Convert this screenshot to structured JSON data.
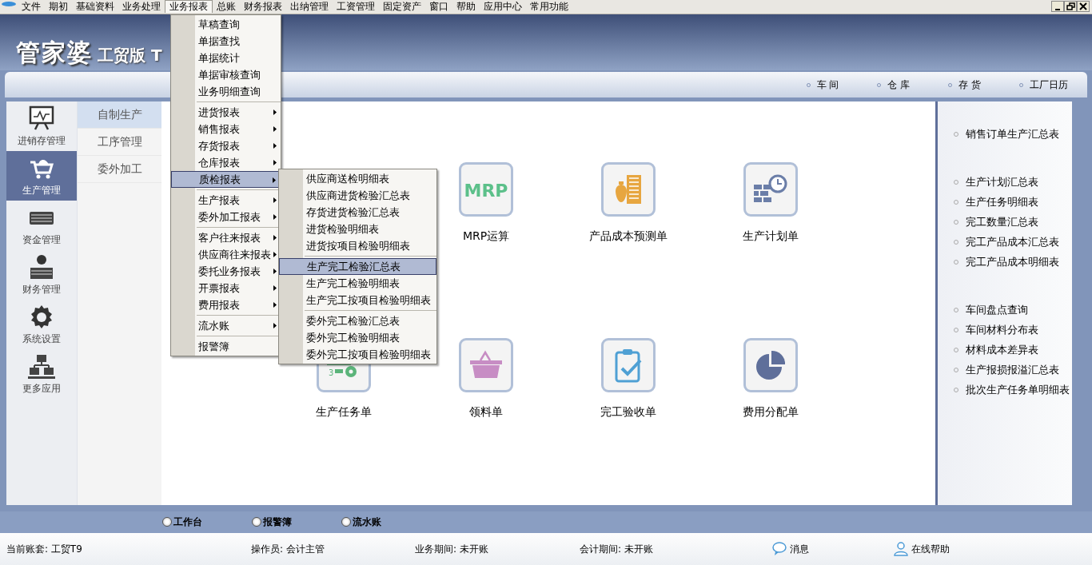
{
  "menubar": {
    "items": [
      {
        "label": "文件",
        "selected": false
      },
      {
        "label": "期初",
        "selected": false
      },
      {
        "label": "基础资料",
        "selected": false
      },
      {
        "label": "业务处理",
        "selected": false
      },
      {
        "label": "业务报表",
        "selected": true
      },
      {
        "label": "总账",
        "selected": false
      },
      {
        "label": "财务报表",
        "selected": false
      },
      {
        "label": "出纳管理",
        "selected": false
      },
      {
        "label": "工资管理",
        "selected": false
      },
      {
        "label": "固定资产",
        "selected": false
      },
      {
        "label": "窗口",
        "selected": false
      },
      {
        "label": "帮助",
        "selected": false
      },
      {
        "label": "应用中心",
        "selected": false
      },
      {
        "label": "常用功能",
        "selected": false
      }
    ]
  },
  "logo": {
    "brand": "管家婆",
    "edition": "工贸版 T"
  },
  "quick_links": [
    "车 间",
    "仓 库",
    "存 货",
    "工厂日历"
  ],
  "modules": [
    {
      "label": "进销存管理",
      "selected": false
    },
    {
      "label": "生产管理",
      "selected": true
    },
    {
      "label": "资金管理",
      "selected": false
    },
    {
      "label": "财务管理",
      "selected": false
    },
    {
      "label": "系统设置",
      "selected": false
    },
    {
      "label": "更多应用",
      "selected": false
    }
  ],
  "subnav": [
    {
      "label": "自制生产",
      "selected": true
    },
    {
      "label": "工序管理",
      "selected": false
    },
    {
      "label": "委外加工",
      "selected": false
    }
  ],
  "tiles": [
    {
      "label": "MRP运算",
      "icon_text": "MRP"
    },
    {
      "label": "产品成本预测单"
    },
    {
      "label": "生产计划单"
    },
    {
      "label": "生产任务单",
      "icon_text": "3"
    },
    {
      "label": "领料单"
    },
    {
      "label": "完工验收单"
    },
    {
      "label": "费用分配单"
    }
  ],
  "reports": [
    [
      "销售订单生产汇总表"
    ],
    [
      "生产计划汇总表",
      "生产任务明细表",
      "完工数量汇总表",
      "完工产品成本汇总表",
      "完工产品成本明细表"
    ],
    [
      "车间盘点查询",
      "车间材料分布表",
      "材料成本差异表",
      "生产报损报溢汇总表",
      "批次生产任务单明细表"
    ]
  ],
  "menu": {
    "groups": [
      [
        {
          "label": "草稿查询",
          "has_submenu": false,
          "selected": false
        },
        {
          "label": "单据查找",
          "has_submenu": false,
          "selected": false
        },
        {
          "label": "单据统计",
          "has_submenu": false,
          "selected": false
        },
        {
          "label": "单据审核查询",
          "has_submenu": false,
          "selected": false
        },
        {
          "label": "业务明细查询",
          "has_submenu": false,
          "selected": false
        }
      ],
      [
        {
          "label": "进货报表",
          "has_submenu": true,
          "selected": false
        },
        {
          "label": "销售报表",
          "has_submenu": true,
          "selected": false
        },
        {
          "label": "存货报表",
          "has_submenu": true,
          "selected": false
        },
        {
          "label": "仓库报表",
          "has_submenu": true,
          "selected": false
        },
        {
          "label": "质检报表",
          "has_submenu": true,
          "selected": true
        }
      ],
      [
        {
          "label": "生产报表",
          "has_submenu": true,
          "selected": false
        },
        {
          "label": "委外加工报表",
          "has_submenu": true,
          "selected": false
        }
      ],
      [
        {
          "label": "客户往来报表",
          "has_submenu": true,
          "selected": false
        },
        {
          "label": "供应商往来报表",
          "has_submenu": true,
          "selected": false
        },
        {
          "label": "委托业务报表",
          "has_submenu": true,
          "selected": false
        },
        {
          "label": "开票报表",
          "has_submenu": true,
          "selected": false
        },
        {
          "label": "费用报表",
          "has_submenu": true,
          "selected": false
        }
      ],
      [
        {
          "label": "流水账",
          "has_submenu": true,
          "selected": false
        }
      ],
      [
        {
          "label": "报警簿",
          "has_submenu": false,
          "selected": false
        }
      ]
    ]
  },
  "submenu": {
    "groups": [
      [
        {
          "label": "供应商送检明细表",
          "selected": false
        },
        {
          "label": "供应商进货检验汇总表",
          "selected": false
        },
        {
          "label": "存货进货检验汇总表",
          "selected": false
        },
        {
          "label": "进货检验明细表",
          "selected": false
        },
        {
          "label": "进货按项目检验明细表",
          "selected": false
        }
      ],
      [
        {
          "label": "生产完工检验汇总表",
          "selected": true
        },
        {
          "label": "生产完工检验明细表",
          "selected": false
        },
        {
          "label": "生产完工按项目检验明细表",
          "selected": false
        }
      ],
      [
        {
          "label": "委外完工检验汇总表",
          "selected": false
        },
        {
          "label": "委外完工检验明细表",
          "selected": false
        },
        {
          "label": "委外完工按项目检验明细表",
          "selected": false
        }
      ]
    ]
  },
  "bottom_tabs": [
    "工作台",
    "报警簿",
    "流水账"
  ],
  "status_bar": {
    "fields": [
      "当前账套: 工贸T9",
      "操作员: 会计主管",
      "业务期间: 未开账",
      "会计期间: 未开账"
    ],
    "links": [
      "消息",
      "在线帮助"
    ]
  }
}
